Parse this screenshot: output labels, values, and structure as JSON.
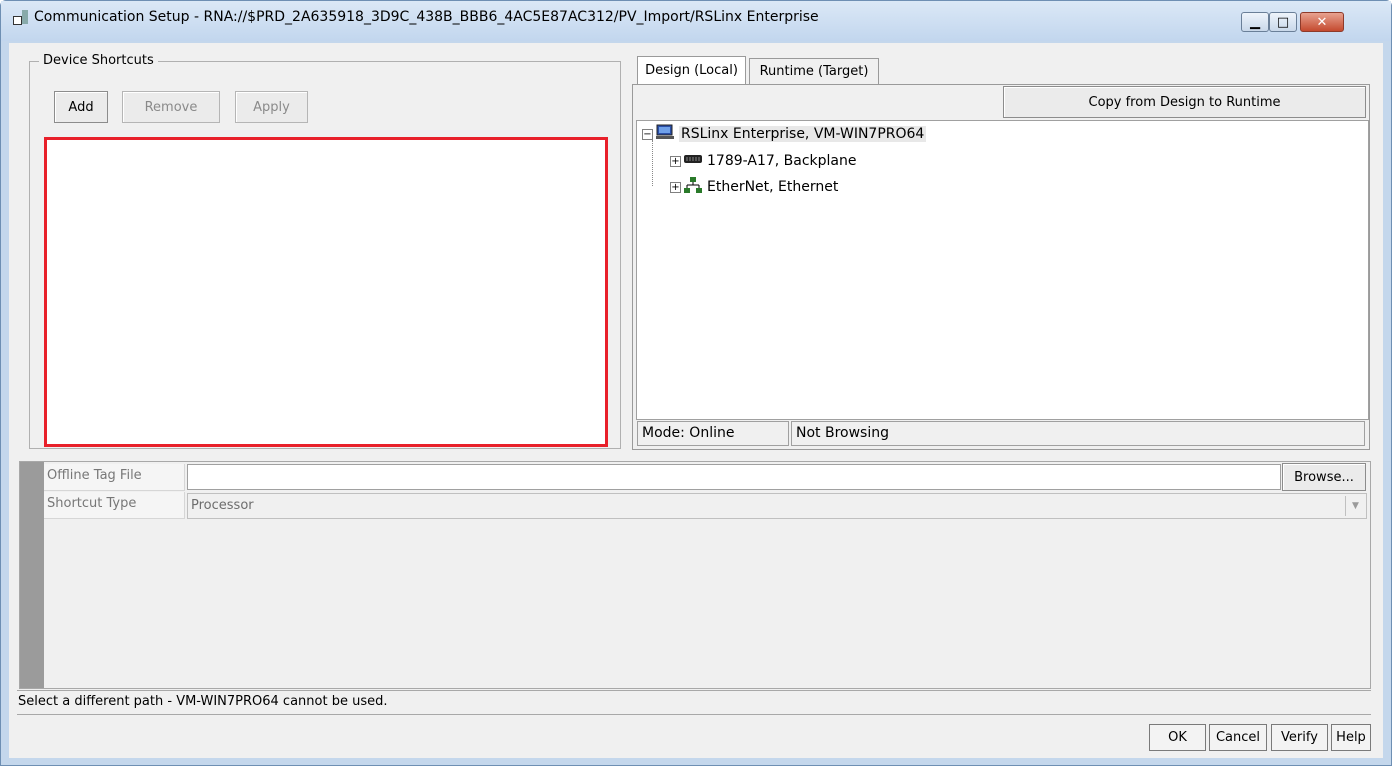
{
  "window": {
    "title": "Communication Setup - RNA://$PRD_2A635918_3D9C_438B_BBB6_4AC5E87AC312/PV_Import/RSLinx Enterprise",
    "minimize_glyph": "▁",
    "maximize_glyph": "□",
    "close_glyph": "✕"
  },
  "shortcuts": {
    "group_label": "Device Shortcuts",
    "add_label": "Add",
    "remove_label": "Remove",
    "apply_label": "Apply"
  },
  "tabs": {
    "design_label": "Design (Local)",
    "runtime_label": "Runtime (Target)",
    "copy_label": "Copy from Design to Runtime"
  },
  "tree": {
    "root": {
      "label": "RSLinx Enterprise, VM-WIN7PRO64",
      "expander": "−",
      "icon": "computer-icon"
    },
    "items": [
      {
        "label": "1789-A17, Backplane",
        "expander": "+",
        "icon": "backplane-icon"
      },
      {
        "label": "EtherNet, Ethernet",
        "expander": "+",
        "icon": "network-icon"
      }
    ]
  },
  "status": {
    "mode": "Mode: Online",
    "browsing": "Not Browsing"
  },
  "properties": {
    "offline_tag_file": {
      "name": "Offline Tag File",
      "value": "",
      "browse_label": "Browse..."
    },
    "shortcut_type": {
      "name": "Shortcut Type",
      "value": "Processor"
    }
  },
  "message": "Select a different path - VM-WIN7PRO64 cannot be used.",
  "buttons": {
    "ok": "OK",
    "cancel": "Cancel",
    "verify": "Verify",
    "help": "Help"
  },
  "colors": {
    "highlight_border": "#e8202a",
    "titlebar": "#c2d6ee",
    "close_button": "#c44a2f"
  }
}
